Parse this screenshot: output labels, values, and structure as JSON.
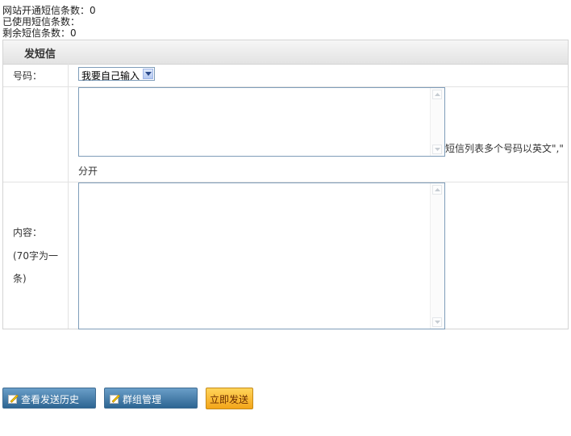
{
  "stats": {
    "opened": "网站开通短信条数：0",
    "used": "已使用短信条数：",
    "remaining": "剩余短信条数：0"
  },
  "panel": {
    "title": "发短信",
    "number_label": "号码：",
    "number_select": {
      "selected": "我要自己输入"
    },
    "number_hint_part1": "短信列表多个号码以英文\",\"",
    "number_hint_part2": "分开",
    "content_label_line1": "内容：",
    "content_label_line2": "(70字为一",
    "content_label_line3": "条)"
  },
  "actions": {
    "history": "查看发送历史",
    "groups": "群组管理",
    "send": "立即发送"
  },
  "colors": {
    "primary_button": "#2d6592",
    "send_button": "#f3a519",
    "border": "#7f9db9"
  }
}
